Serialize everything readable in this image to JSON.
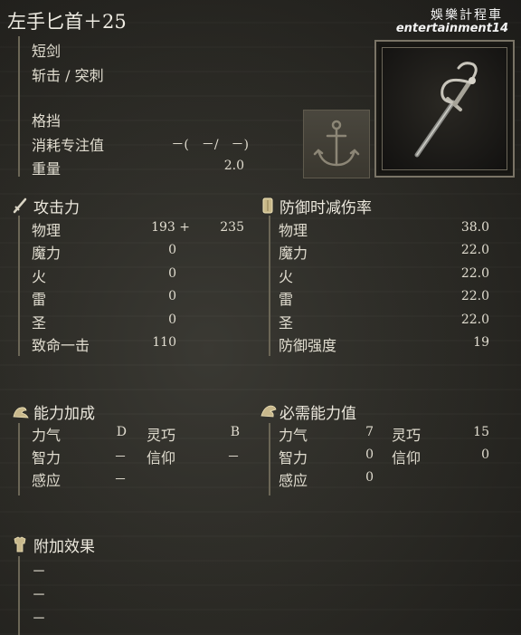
{
  "title": "左手匕首＋25",
  "watermark": {
    "line1": "娛樂計程車",
    "line2": "entertainment14"
  },
  "info": {
    "type": "短剑",
    "damage_type": "斩击 / 突刺",
    "skill": "格挡",
    "fp_label": "消耗专注值",
    "fp_value": "－(　－/　－)",
    "weight_label": "重量",
    "weight_value": "2.0"
  },
  "attack": {
    "header": "攻击力",
    "rows": [
      {
        "label": "物理",
        "base": "193 +",
        "bonus": "235"
      },
      {
        "label": "魔力",
        "base": "0",
        "bonus": ""
      },
      {
        "label": "火",
        "base": "0",
        "bonus": ""
      },
      {
        "label": "雷",
        "base": "0",
        "bonus": ""
      },
      {
        "label": "圣",
        "base": "0",
        "bonus": ""
      },
      {
        "label": "致命一击",
        "base": "110",
        "bonus": ""
      }
    ]
  },
  "guard": {
    "header": "防御时减伤率",
    "rows": [
      {
        "label": "物理",
        "value": "38.0"
      },
      {
        "label": "魔力",
        "value": "22.0"
      },
      {
        "label": "火",
        "value": "22.0"
      },
      {
        "label": "雷",
        "value": "22.0"
      },
      {
        "label": "圣",
        "value": "22.0"
      },
      {
        "label": "防御强度",
        "value": "19"
      }
    ]
  },
  "scaling": {
    "header": "能力加成",
    "rows": [
      {
        "l1": "力气",
        "v1": "D",
        "l2": "灵巧",
        "v2": "B"
      },
      {
        "l1": "智力",
        "v1": "－",
        "l2": "信仰",
        "v2": "－"
      },
      {
        "l1": "感应",
        "v1": "－",
        "l2": "",
        "v2": ""
      }
    ]
  },
  "requirements": {
    "header": "必需能力值",
    "rows": [
      {
        "l1": "力气",
        "v1": "7",
        "l2": "灵巧",
        "v2": "15"
      },
      {
        "l1": "智力",
        "v1": "0",
        "l2": "信仰",
        "v2": "0"
      },
      {
        "l1": "感应",
        "v1": "0",
        "l2": "",
        "v2": ""
      }
    ]
  },
  "effects": {
    "header": "附加效果",
    "items": [
      "－",
      "－",
      "－"
    ]
  },
  "icons": {
    "attack": "sword-icon",
    "guard": "shield-icon",
    "scaling": "arm-icon",
    "requirements": "hand-icon",
    "effects": "armor-icon",
    "ash": "anchor-icon",
    "weapon": "dagger-icon"
  }
}
